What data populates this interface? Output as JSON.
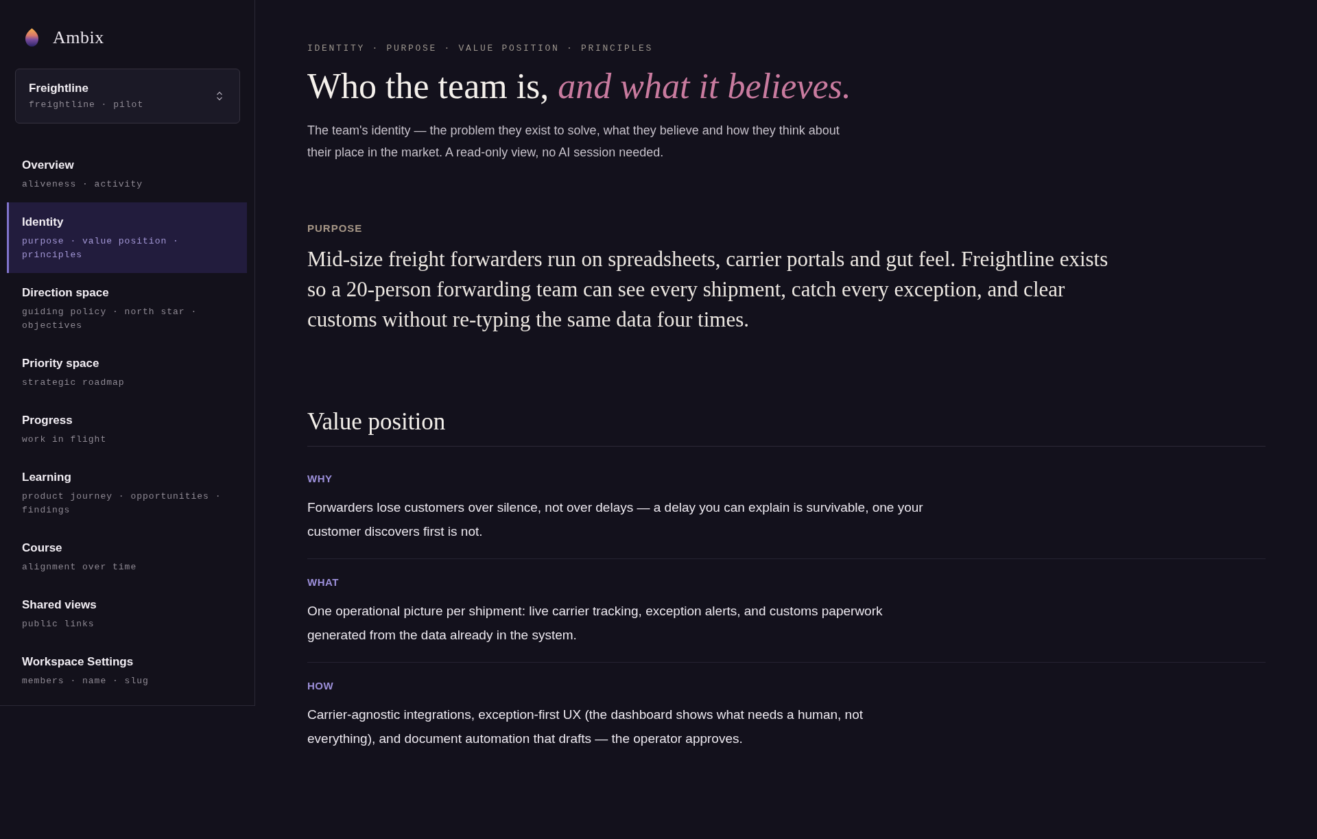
{
  "sidebar": {
    "brand": "Ambix",
    "workspace": {
      "name": "Freightline",
      "subtitle": "freightline · pilot"
    },
    "items": [
      {
        "label": "Overview",
        "description": "aliveness · activity",
        "selected": false
      },
      {
        "label": "Identity",
        "description": "purpose · value position · principles",
        "selected": true
      },
      {
        "label": "Direction space",
        "description": "guiding policy · north star · objectives",
        "selected": false
      },
      {
        "label": "Priority space",
        "description": "strategic roadmap",
        "selected": false
      },
      {
        "label": "Progress",
        "description": "work in flight",
        "selected": false
      },
      {
        "label": "Learning",
        "description": "product journey · opportunities · findings",
        "selected": false
      },
      {
        "label": "Course",
        "description": "alignment over time",
        "selected": false
      },
      {
        "label": "Shared views",
        "description": "public links",
        "selected": false
      },
      {
        "label": "Workspace Settings",
        "description": "members · name · slug",
        "selected": false
      }
    ]
  },
  "header": {
    "breadcrumb": "IDENTITY · PURPOSE · VALUE POSITION · PRINCIPLES",
    "title": "Who the team is, *and what it believes.*",
    "description": "The team's identity — the problem they exist to solve, what they believe and how they think about their place in the market. A read-only view, no AI session needed."
  },
  "purpose": {
    "label": "PURPOSE",
    "text": "Mid-size freight forwarders run on spreadsheets, carrier portals and gut feel. Freightline exists so a 20-person forwarding team can see every shipment, catch every exception, and clear customs without re-typing the same data four times."
  },
  "value_position": {
    "heading": "Value position",
    "items": [
      {
        "label": "WHY",
        "text": "Forwarders lose customers over silence, not over delays — a delay you can explain is survivable, one your customer discovers first is not."
      },
      {
        "label": "WHAT",
        "text": "One operational picture per shipment: live carrier tracking, exception alerts, and customs paperwork generated from the data already in the system."
      },
      {
        "label": "HOW",
        "text": "Carrier-agnostic integrations, exception-first UX (the dashboard shows what needs a human, not everything), and document automation that drafts — the operator approves."
      }
    ]
  }
}
